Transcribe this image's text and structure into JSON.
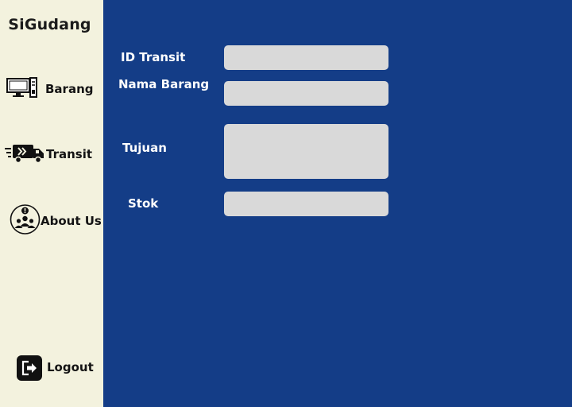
{
  "app": {
    "title": "SiGudang"
  },
  "sidebar": {
    "items": [
      {
        "label": "Barang",
        "icon": "computer-icon"
      },
      {
        "label": "Transit",
        "icon": "delivery-truck-icon"
      },
      {
        "label": "About Us",
        "icon": "team-info-icon"
      },
      {
        "label": "Logout",
        "icon": "logout-icon"
      }
    ]
  },
  "form": {
    "id_transit": {
      "label": "ID Transit",
      "value": ""
    },
    "nama_barang": {
      "label": "Nama Barang",
      "value": ""
    },
    "tujuan": {
      "label": "Tujuan",
      "value": ""
    },
    "stok": {
      "label": "Stok",
      "value": ""
    }
  },
  "colors": {
    "sidebar_bg": "#f3f2de",
    "main_bg": "#143d87",
    "input_bg": "#d9d9d9",
    "label_text": "#ffffff"
  }
}
